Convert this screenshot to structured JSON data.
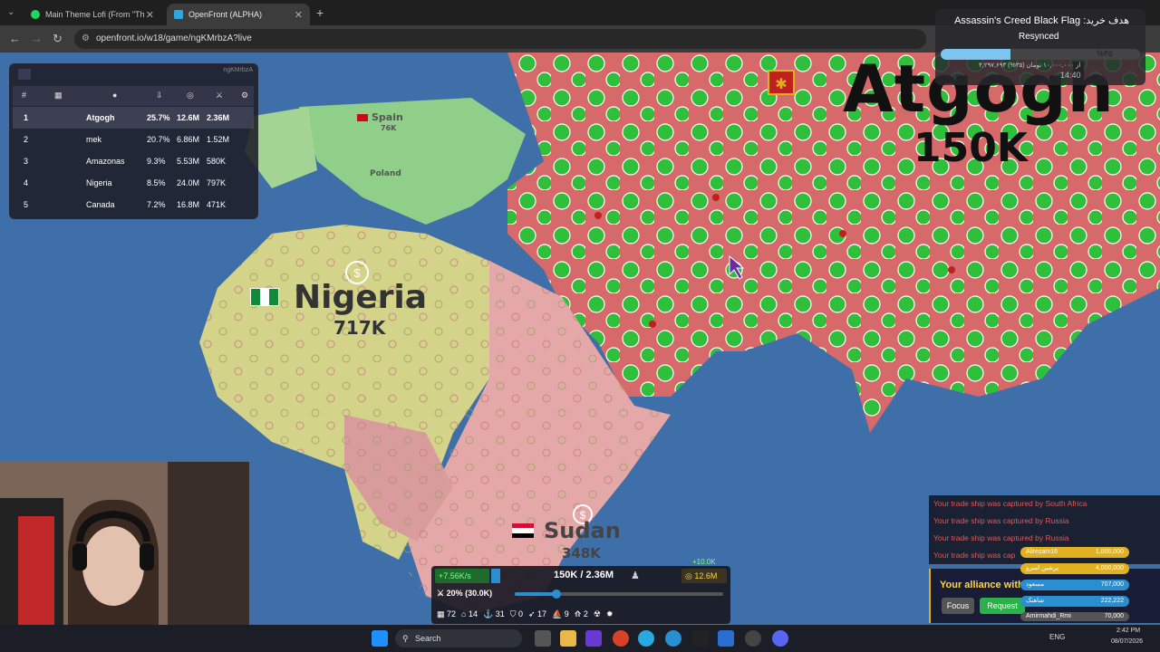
{
  "browser": {
    "tabs": [
      {
        "title": "Main Theme Lofi (From \"Th",
        "active": false
      },
      {
        "title": "OpenFront (ALPHA)",
        "active": true
      }
    ],
    "url": "openfront.io/w18/game/ngKMrbzA?live"
  },
  "map": {
    "labels": {
      "atgogh_name": "Atgogh",
      "atgogh_troops": "150K",
      "nigeria_name": "Nigeria",
      "nigeria_troops": "717K",
      "sudan_name": "Sudan",
      "sudan_troops": "348K",
      "spain": "Spain",
      "spain_troops": "76K",
      "poland": "Poland"
    }
  },
  "leaderboard": {
    "game_id": "ngKMrbzA",
    "columns": [
      "#",
      "",
      "",
      "",
      "",
      "",
      ""
    ],
    "rows": [
      {
        "rank": "1",
        "name": "Atgogh",
        "land": "25.7%",
        "gold": "12.6M",
        "troops": "2.36M"
      },
      {
        "rank": "2",
        "name": "mek",
        "land": "20.7%",
        "gold": "6.86M",
        "troops": "1.52M"
      },
      {
        "rank": "3",
        "name": "Amazonas",
        "land": "9.3%",
        "gold": "5.53M",
        "troops": "580K"
      },
      {
        "rank": "4",
        "name": "Nigeria",
        "land": "8.5%",
        "gold": "24.0M",
        "troops": "797K"
      },
      {
        "rank": "5",
        "name": "Canada",
        "land": "7.2%",
        "gold": "16.8M",
        "troops": "471K"
      }
    ]
  },
  "notifications": [
    "Your trade ship was captured by South Africa",
    "Your trade ship was captured by Russia",
    "Your trade ship was captured by Russia",
    "Your trade ship was cap"
  ],
  "alliance": {
    "title": "Your alliance with",
    "focus": "Focus",
    "request": "Request"
  },
  "donations": [
    {
      "name": "Alirezam16",
      "amount": "1,000,000",
      "color": "#e0b020"
    },
    {
      "name": "پرشین امیرو",
      "amount": "4,000,000",
      "color": "#e0b020"
    },
    {
      "name": "مسعود",
      "amount": "707,000",
      "color": "#2a8fd0"
    },
    {
      "name": "شاهنک",
      "amount": "222,222",
      "color": "#2a8fd0"
    },
    {
      "name": "Amirmahdi_Rmi",
      "amount": "70,000",
      "color": "#555"
    },
    {
      "name": "farid.h.b",
      "amount": "50,000",
      "color": "#555"
    }
  ],
  "control": {
    "income": "+7.56K/s",
    "troops": "150K / 2.36M",
    "gold": "12.6M",
    "gold_delta": "+10.0K",
    "attack_ratio": "20% (30.0K)",
    "attack_ratio_value": 0.2,
    "buildings": [
      {
        "icon": "city-icon",
        "count": "72"
      },
      {
        "icon": "factory-icon",
        "count": "14"
      },
      {
        "icon": "port-icon",
        "count": "31"
      },
      {
        "icon": "defense-icon",
        "count": "0"
      },
      {
        "icon": "missile-icon",
        "count": "17"
      },
      {
        "icon": "warship-icon",
        "count": "9"
      },
      {
        "icon": "sam-icon",
        "count": "2"
      }
    ]
  },
  "overlay": {
    "title": "Assassin's Creed Black Flag :هدف خرید",
    "status": "Resynced",
    "percent": "%۳۵",
    "amount_text": "۴,۲۹۷,۶۹۳ از ۱۰,۰۰۰,۰۰۰ تومان (۳۵%)",
    "progress": 0.35,
    "clock": "14:40"
  },
  "taskbar": {
    "search": "Search",
    "lang": "ENG",
    "time": "2:42 PM",
    "date": "08/07/2026"
  },
  "colors": {
    "atgogh_territory": "#d66a6a",
    "nigeria_territory": "#d4d38a",
    "tree_green": "#2fbf3a",
    "ocean": "#3f6fa8"
  }
}
